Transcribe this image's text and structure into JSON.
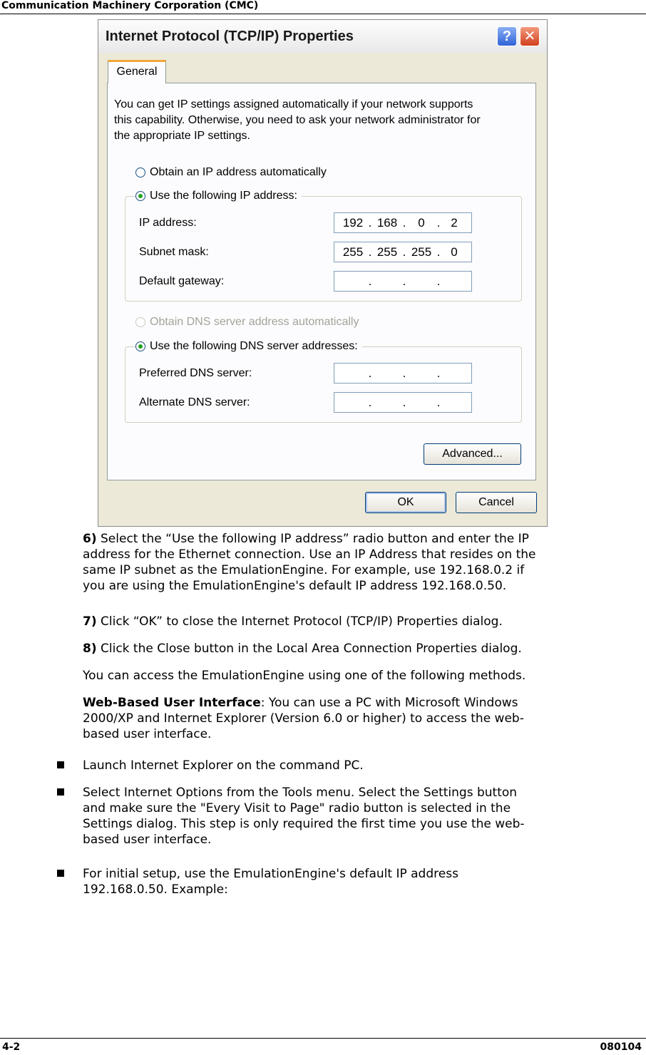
{
  "header": {
    "company": "Communication Machinery Corporation (CMC)"
  },
  "dialog": {
    "title": "Internet Protocol (TCP/IP) Properties",
    "help_glyph": "?",
    "close_glyph": "✕",
    "tab": "General",
    "intro_lines": [
      "You can get IP settings assigned automatically if your network supports",
      "this capability. Otherwise, you need to ask your network administrator for",
      "the appropriate IP settings."
    ],
    "radio_auto_ip": "Obtain an IP address automatically",
    "radio_use_ip": "Use the following IP address:",
    "ip_label": "IP address:",
    "ip_value": [
      "192",
      "168",
      "0",
      "2"
    ],
    "subnet_label": "Subnet mask:",
    "subnet_value": [
      "255",
      "255",
      "255",
      "0"
    ],
    "gateway_label": "Default gateway:",
    "radio_auto_dns": "Obtain DNS server address automatically",
    "radio_use_dns": "Use the following DNS server addresses:",
    "preferred_dns_label": "Preferred DNS server:",
    "alternate_dns_label": "Alternate DNS server:",
    "advanced_button": "Advanced...",
    "ok_button": "OK",
    "cancel_button": "Cancel"
  },
  "body": {
    "step6_num": "6)",
    "step6_lines": [
      " Select the “Use the following IP address” radio button and enter the IP",
      "address for the Ethernet connection. Use an IP Address that resides on the",
      "same IP subnet as the EmulationEngine. For example, use 192.168.0.2 if",
      "you are using the EmulationEngine's default IP address 192.168.0.50."
    ],
    "step7_num": "7)",
    "step7_text": " Click “OK” to close the Internet Protocol (TCP/IP) Properties dialog.",
    "step8_num": "8)",
    "step8_text": " Click the Close button in the Local Area Connection Properties dialog.",
    "access_text": "You can access the EmulationEngine using one of the following methods.",
    "web_heading": "Web-Based User Interface",
    "web_lines": [
      ": You can use a PC with Microsoft Windows",
      "2000/XP and Internet Explorer (Version 6.0 or higher) to access the web-",
      "based user interface."
    ],
    "bullet1": "Launch Internet Explorer on the command PC.",
    "bullet2_lines": [
      "Select Internet Options from the Tools menu. Select the Settings button",
      "and make sure the \"Every Visit to Page\" radio button is selected in the",
      "Settings dialog. This step is only required the first time you use the web-",
      "based user interface."
    ],
    "bullet3_lines": [
      "For initial setup, use the EmulationEngine's default IP address",
      "192.168.0.50. Example:"
    ]
  },
  "footer": {
    "page_number": "4-2",
    "doc_code": "080104"
  }
}
